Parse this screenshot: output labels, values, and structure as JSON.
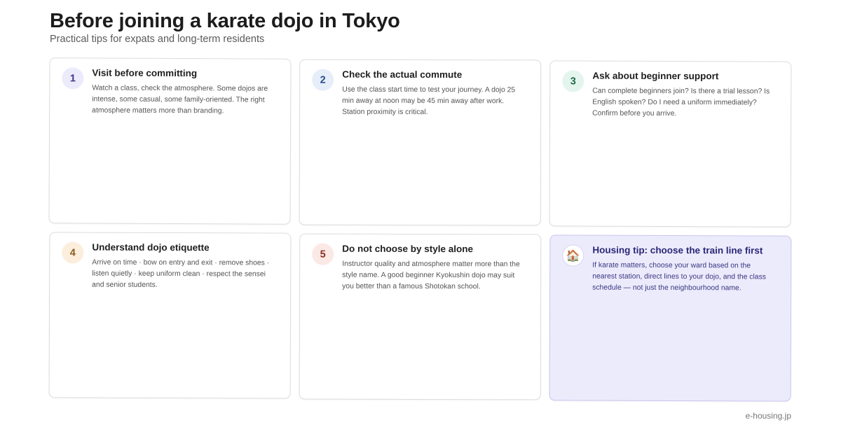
{
  "header": {
    "title": "Before joining a karate dojo in Tokyo",
    "subtitle": "Practical tips for expats and long-term residents"
  },
  "cards": [
    {
      "badge": "1",
      "title": "Visit before committing",
      "body": "Watch a class, check the atmosphere. Some dojos are intense, some casual, some family-oriented. The right atmosphere matters more than branding."
    },
    {
      "badge": "2",
      "title": "Check the actual commute",
      "body": "Use the class start time to test your journey. A dojo 25 min away at noon may be 45 min away after work. Station proximity is critical."
    },
    {
      "badge": "3",
      "title": "Ask about beginner support",
      "body": "Can complete beginners join? Is there a trial lesson? Is English spoken? Do I need a uniform immediately? Confirm before you arrive."
    },
    {
      "badge": "4",
      "title": "Understand dojo etiquette",
      "body": "Arrive on time · bow on entry and exit · remove shoes · listen quietly · keep uniform clean · respect the sensei and senior students."
    },
    {
      "badge": "5",
      "title": "Do not choose by style alone",
      "body": "Instructor quality and atmosphere matter more than the style name. A good beginner Kyokushin dojo may suit you better than a famous Shotokan school."
    },
    {
      "badge": "🏠",
      "icon": "house-icon",
      "title": "Housing tip: choose the train line first",
      "body": "If karate matters, choose your ward based on the nearest station, direct lines to your dojo, and the class schedule — not just the neighbourhood name."
    }
  ],
  "footer": {
    "source": "e-housing.jp"
  },
  "colors": {
    "highlight_card_bg": "#ecebfc",
    "highlight_text": "#2a2775"
  }
}
